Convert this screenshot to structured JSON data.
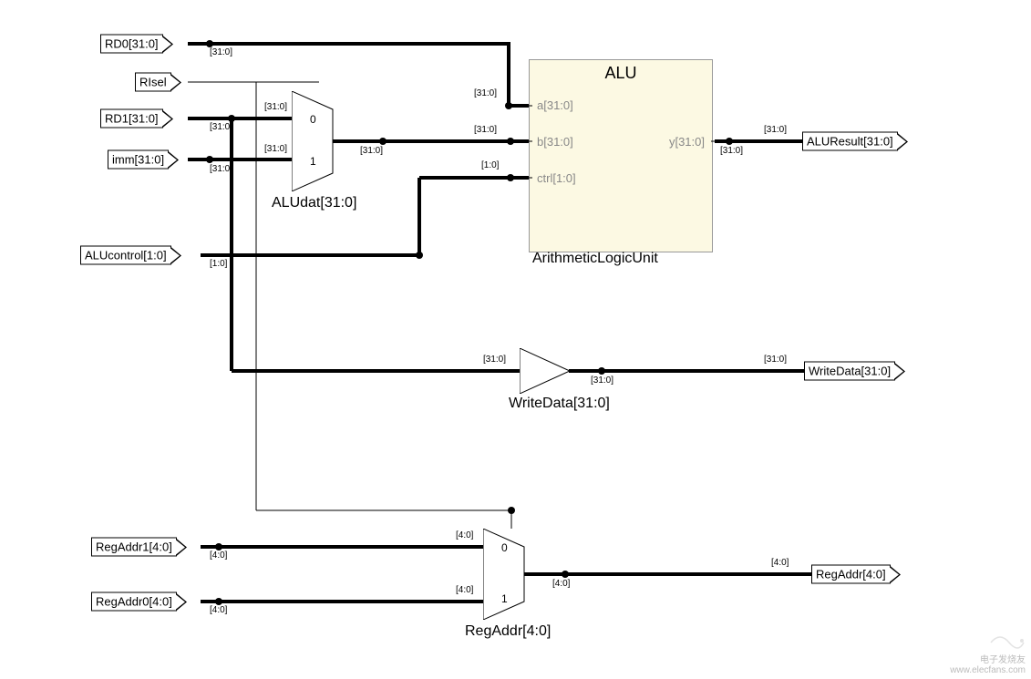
{
  "inputs": {
    "rd0": {
      "label": "RD0[31:0]",
      "bus": "[31:0]"
    },
    "risel": {
      "label": "RIsel",
      "bus": ""
    },
    "rd1": {
      "label": "RD1[31:0]",
      "bus": "[31:0]"
    },
    "imm": {
      "label": "imm[31:0]",
      "bus": "[31:0]"
    },
    "alucontrol": {
      "label": "ALUcontrol[1:0]",
      "bus": "[1:0]"
    },
    "regaddr1": {
      "label": "RegAddr1[4:0]",
      "bus": "[4:0]"
    },
    "regaddr0": {
      "label": "RegAddr0[4:0]",
      "bus": "[4:0]"
    }
  },
  "outputs": {
    "aluresult": {
      "label": "ALUResult[31:0]",
      "bus": "[31:0]"
    },
    "writedata": {
      "label": "WriteData[31:0]",
      "bus": "[31:0]"
    },
    "regaddr": {
      "label": "RegAddr[4:0]",
      "bus": "[4:0]"
    }
  },
  "mux_aludat": {
    "title": "ALUdat[31:0]",
    "in0_bus": "[31:0]",
    "in1_bus": "[31:0]",
    "out_bus": "[31:0]",
    "in0_idx": "0",
    "in1_idx": "1"
  },
  "mux_regaddr": {
    "title": "RegAddr[4:0]",
    "in0_bus": "[4:0]",
    "in1_bus": "[4:0]",
    "out_bus": "[4:0]",
    "in0_idx": "0",
    "in1_idx": "1"
  },
  "alu": {
    "title": "ALU",
    "subtitle": "ArithmeticLogicUnit",
    "a": "a[31:0]",
    "b": "b[31:0]",
    "ctrl": "ctrl[1:0]",
    "y": "y[31:0]",
    "a_bus": "[31:0]",
    "b_bus": "[31:0]",
    "ctrl_bus": "[1:0]",
    "y_left_bus": "[31:0]",
    "y_right_bus": "[31:0]"
  },
  "writedata_buf": {
    "title": "WriteData[31:0]",
    "in_bus": "[31:0]",
    "out_bus": "[31:0]"
  },
  "watermark": {
    "line1": "电子发烧友",
    "line2": "www.elecfans.com"
  }
}
